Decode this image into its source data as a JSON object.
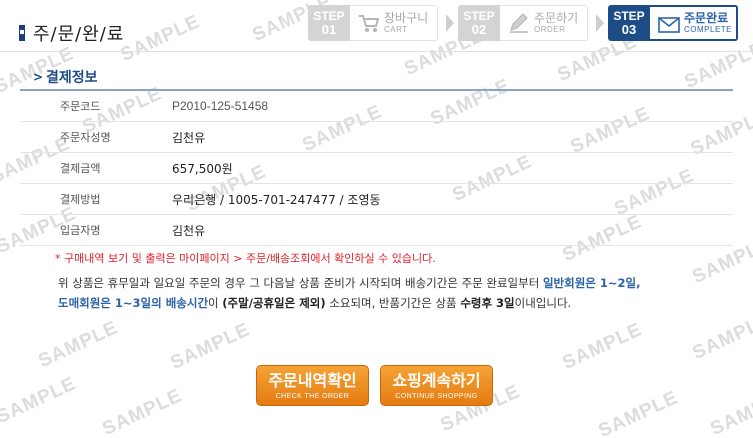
{
  "header": {
    "page_title": "주/문/완/료",
    "steps": [
      {
        "num_top": "STEP",
        "num_bottom": "01",
        "label": "장바구니",
        "sub": "CART",
        "icon": "cart-icon",
        "state": "inactive"
      },
      {
        "num_top": "STEP",
        "num_bottom": "02",
        "label": "주문하기",
        "sub": "ORDER",
        "icon": "pencil-icon",
        "state": "inactive"
      },
      {
        "num_top": "STEP",
        "num_bottom": "03",
        "label": "주문완료",
        "sub": "COMPLETE",
        "icon": "envelope-icon",
        "state": "active"
      }
    ]
  },
  "section": {
    "title": "결제정보",
    "rows": [
      {
        "label": "주문코드",
        "value": "P2010-125-51458"
      },
      {
        "label": "주문자성명",
        "value": "김천유"
      },
      {
        "label": "결제금액",
        "value": "657,500원"
      },
      {
        "label": "결제방법",
        "value": "우리은행 / 1005-701-247477 / 조영동"
      },
      {
        "label": "입금자명",
        "value": "김천유"
      }
    ]
  },
  "notice": "* 구매내역 보기 및 출력은 마이페이지 > 주문/배송조회에서 확인하실 수 있습니다.",
  "description": {
    "p1": "위 상품은 휴무일과 일요일 주문의 경우 그 다음날 상품 준비가 시작되며 배송기간은 주문 완료일부터 ",
    "hl1": "일반회원은 1~2일,",
    "hl2": "도매회원은 1~3일의 배송시간",
    "p2": "이 ",
    "bold1": "(주말/공휴일은 제외)",
    "p3": " 소요되며, 반품기간은 상품 ",
    "bold2": "수령후 3일",
    "p4": "이내입니다."
  },
  "buttons": {
    "order_main": "주문내역확인",
    "order_sub": "CHECK THE ORDER",
    "shop_main": "쇼핑계속하기",
    "shop_sub": "CONTINUE SHOPPING"
  },
  "watermark": "SAMPLE",
  "colors": {
    "accent_blue": "#1e4c86",
    "notice_red": "#e0202a",
    "button_orange": "#e57b12"
  }
}
